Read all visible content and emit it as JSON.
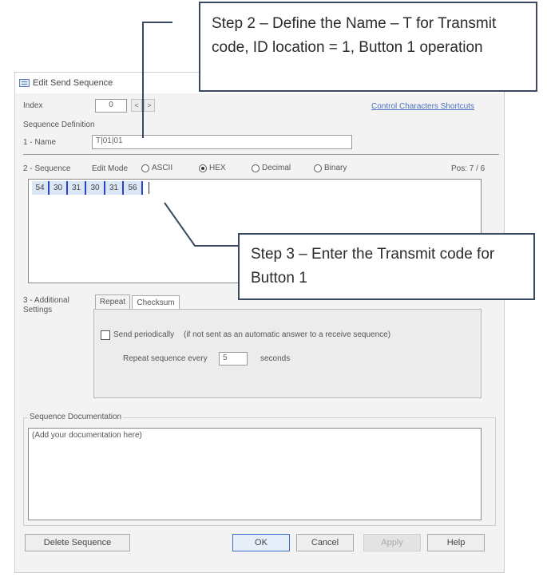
{
  "dialog": {
    "title": "Edit Send Sequence",
    "index_label": "Index",
    "index_value": "0",
    "index_prev": "<",
    "index_next": ">",
    "control_chars_link": "Control Characters Shortcuts",
    "sequence_definition_label": "Sequence Definition",
    "name_label": "1 - Name",
    "name_value": "T|01|01",
    "sequence_label": "2 - Sequence",
    "edit_mode_label": "Edit Mode",
    "modes": [
      {
        "label": "ASCII",
        "selected": false
      },
      {
        "label": "HEX",
        "selected": true
      },
      {
        "label": "Decimal",
        "selected": false
      },
      {
        "label": "Binary",
        "selected": false
      }
    ],
    "pos_text": "Pos: 7 / 6",
    "bytes": [
      "54",
      "30",
      "31",
      "30",
      "31",
      "56"
    ],
    "additional_label": "3 - Additional Settings",
    "tabs": [
      {
        "label": "Repeat",
        "active": true
      },
      {
        "label": "Checksum",
        "active": false
      }
    ],
    "send_periodically_label": "Send periodically",
    "send_periodically_note": "(if not sent as an automatic answer to a receive sequence)",
    "repeat_every_label": "Repeat sequence every",
    "repeat_value": "5",
    "repeat_unit": "seconds",
    "documentation_label": "Sequence Documentation",
    "documentation_placeholder": "(Add your documentation here)",
    "buttons": {
      "delete": "Delete Sequence",
      "ok": "OK",
      "cancel": "Cancel",
      "apply": "Apply",
      "help": "Help"
    }
  },
  "callouts": {
    "step2": "Step 2 – Define the Name – T for Transmit code, ID location = 1, Button 1 operation",
    "step3": "Step 3 – Enter the Transmit code for Button 1"
  },
  "colors": {
    "callout_border": "#3a4a63",
    "byte_separator": "#2a44c8",
    "link": "#4a6fbf"
  }
}
